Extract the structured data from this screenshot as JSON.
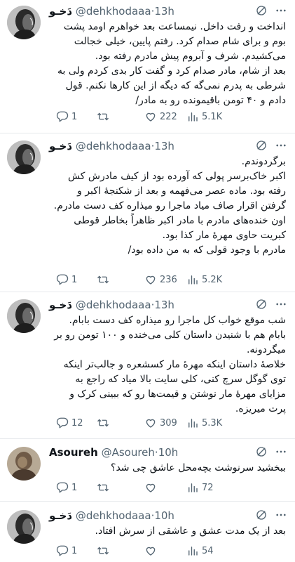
{
  "icons": {
    "grok": "grok-icon",
    "more": "more-icon",
    "reply": "reply-icon",
    "retweet": "retweet-icon",
    "like": "like-icon",
    "views": "views-icon"
  },
  "tweets": [
    {
      "name": "دَخـو",
      "handle": "@dehkhodaaa",
      "time": "13h",
      "paragraphs": [
        "انداخت و رفت داخل. نیمساعت بعد خواهرم اومد پشت بوم و برای شام صدام کرد. رفتم پایین، خیلی خجالت می‌کشیدم. شرف و آبروم پیش مادرم رفته بود.",
        "بعد از شام، مادر صدام کرد و گفت کار بدی کردم ولی به شرطی به پدرم نمی‌گه که دیگه از این کارها نکنم. قول دادم و ۴۰ تومن باقیمونده رو به مادر/"
      ],
      "replies": "1",
      "retweets": "",
      "likes": "222",
      "views": "5.1K"
    },
    {
      "name": "دَخـو",
      "handle": "@dehkhodaaa",
      "time": "13h",
      "paragraphs": [
        "برگردوندم.",
        "اکبر خاک‌برسر پولی که آورده بود از کیف مادرش کش رفته بود. ماده عصر می‌فهمه و بعد از شکنجهٔ اکبر و گرفتن اقرار صاف میاد ماجرا رو میذاره کف دست مادرم.",
        "اون خنده‌های مادرم با مادر اکبر ظاهراً بخاطر قوطی کبریت حاوی مهرهٔ مار کذا بود.",
        "مادرم با وجود قولی که به من داده بود/"
      ],
      "replies": "1",
      "retweets": "",
      "likes": "236",
      "views": "5.2K"
    },
    {
      "name": "دَخـو",
      "handle": "@dehkhodaaa",
      "time": "13h",
      "paragraphs": [
        "شب موقع خواب کل ماجرا رو میذاره کف دست بابام. بابام هم با شنیدن داستان کلی می‌خنده و ۱۰۰ تومن رو بر میگردونه.",
        "خلاصهٔ داستان اینکه مهرهٔ مار کسشعره و جالب‌تر اینکه توی گوگل سرچ کنی، کلی سایت بالا میاد که راجع به مزایای مهرهٔ مار نوشتن و قیمت‌ها رو که ببینی کرک و پرت میریزه."
      ],
      "replies": "12",
      "retweets": "",
      "likes": "309",
      "views": "5.3K"
    },
    {
      "name": "Asoureh",
      "handle": "@Asoureh",
      "time": "10h",
      "paragraphs": [
        "ببخشید سرنوشت بچه‌محل عاشق چی شد؟"
      ],
      "replies": "1",
      "retweets": "",
      "likes": "",
      "views": "72"
    },
    {
      "name": "دَخـو",
      "handle": "@dehkhodaaa",
      "time": "10h",
      "paragraphs": [
        "بعد از یک مدت عشق و عاشقی از سرش افتاد."
      ],
      "replies": "1",
      "retweets": "",
      "likes": "",
      "views": "54"
    }
  ]
}
